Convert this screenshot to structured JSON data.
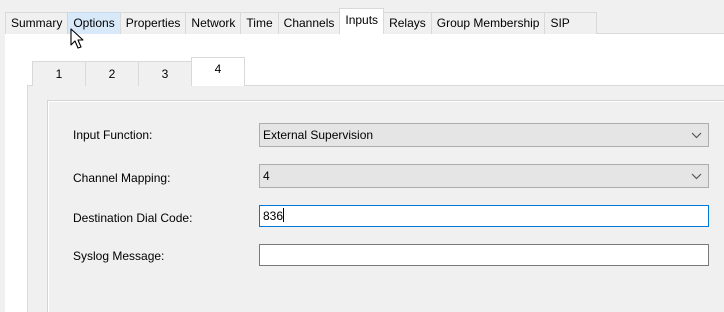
{
  "top_tabs": [
    {
      "label": "Summary"
    },
    {
      "label": "Options"
    },
    {
      "label": "Properties"
    },
    {
      "label": "Network"
    },
    {
      "label": "Time"
    },
    {
      "label": "Channels"
    },
    {
      "label": "Inputs"
    },
    {
      "label": "Relays"
    },
    {
      "label": "Group Membership"
    },
    {
      "label": "SIP"
    }
  ],
  "active_top_tab": "Inputs",
  "hovered_top_tab": "Options",
  "sub_tabs": [
    {
      "label": "1"
    },
    {
      "label": "2"
    },
    {
      "label": "3"
    },
    {
      "label": "4"
    }
  ],
  "active_sub_tab": "4",
  "form": {
    "input_function": {
      "label": "Input Function:",
      "value": "External Supervision"
    },
    "channel_mapping": {
      "label": "Channel Mapping:",
      "value": "4"
    },
    "destination_dial_code": {
      "label": "Destination Dial Code:",
      "value": "836"
    },
    "syslog_message": {
      "label": "Syslog Message:",
      "value": ""
    }
  },
  "icons": {
    "cursor": "mouse-pointer-icon",
    "dropdown": "chevron-down-icon"
  },
  "colors": {
    "hover_tab": "#d8eaf9",
    "focus_border": "#0078d7",
    "panel": "#f0f0f0"
  }
}
